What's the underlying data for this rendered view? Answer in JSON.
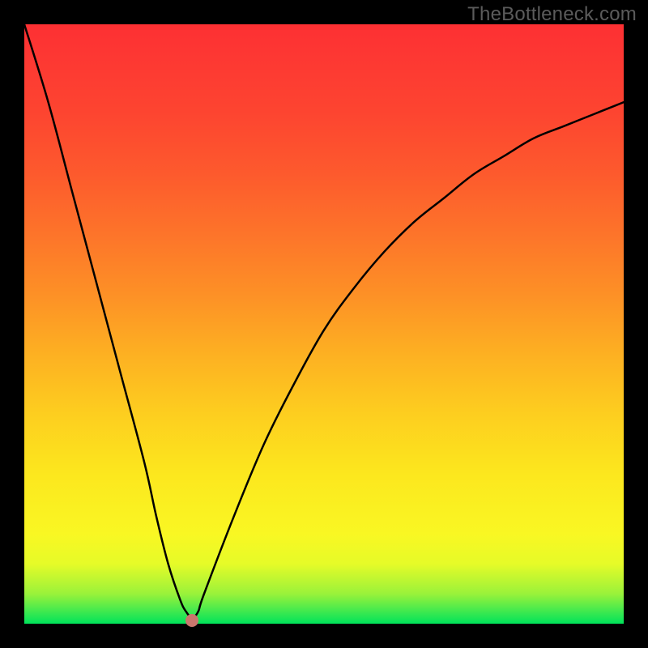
{
  "watermark": {
    "text": "TheBottleneck.com"
  },
  "colors": {
    "curve": "#000000",
    "marker": "#c9766d",
    "frame": "#000000"
  },
  "chart_data": {
    "type": "line",
    "title": "",
    "xlabel": "",
    "ylabel": "",
    "xlim": [
      0,
      100
    ],
    "ylim": [
      0,
      100
    ],
    "grid": false,
    "legend": false,
    "series": [
      {
        "name": "bottleneck-curve",
        "x": [
          0,
          4,
          8,
          12,
          16,
          20,
          22,
          24,
          26,
          27,
          28,
          29,
          30,
          35,
          40,
          45,
          50,
          55,
          60,
          65,
          70,
          75,
          80,
          85,
          90,
          95,
          100
        ],
        "values": [
          100,
          87,
          72,
          57,
          42,
          27,
          18,
          10,
          4,
          2,
          1,
          2,
          5,
          18,
          30,
          40,
          49,
          56,
          62,
          67,
          71,
          75,
          78,
          81,
          83,
          85,
          87
        ]
      }
    ],
    "marker": {
      "x": 28,
      "y": 0.5
    },
    "background_gradient": [
      {
        "pos": 0,
        "color": "#fd3033"
      },
      {
        "pos": 50,
        "color": "#fdc020"
      },
      {
        "pos": 88,
        "color": "#f9f723"
      },
      {
        "pos": 100,
        "color": "#00e35a"
      }
    ]
  }
}
